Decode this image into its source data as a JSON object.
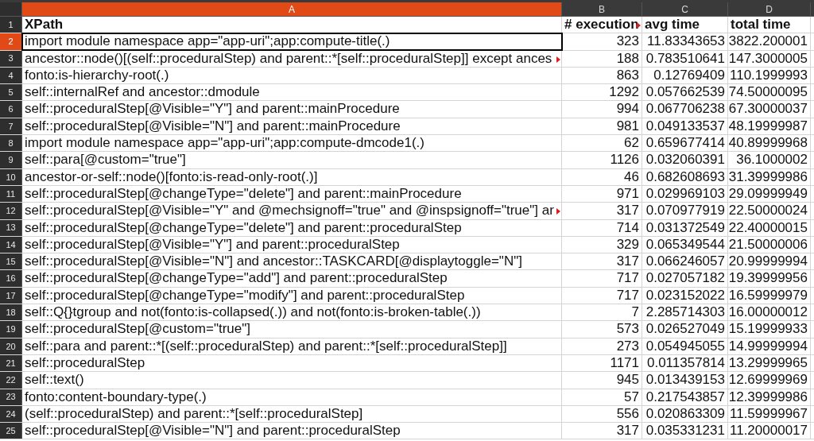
{
  "columns": [
    {
      "letter": "A",
      "selected": true
    },
    {
      "letter": "B",
      "selected": false
    },
    {
      "letter": "C",
      "selected": false
    },
    {
      "letter": "D",
      "selected": false
    }
  ],
  "rows": [
    {
      "number": "1",
      "selected": false,
      "kind": "header",
      "cells": [
        {
          "text": "XPath",
          "overflow": false
        },
        {
          "text": "# execution",
          "overflow": true
        },
        {
          "text": "avg time",
          "overflow": false
        },
        {
          "text": "total time",
          "overflow": false
        }
      ]
    },
    {
      "number": "2",
      "selected": true,
      "kind": "data",
      "cells": [
        {
          "text": "import module namespace app=\"app-uri\";app:compute-title(.)",
          "overflow": false
        },
        {
          "text": "323",
          "overflow": false
        },
        {
          "text": "11.83343653",
          "overflow": false
        },
        {
          "text": "3822.200001",
          "overflow": false
        }
      ]
    },
    {
      "number": "3",
      "selected": false,
      "kind": "data",
      "cells": [
        {
          "text": "ancestor::node()[(self::proceduralStep) and parent::*[self::proceduralStep]] except ances",
          "overflow": true
        },
        {
          "text": "188",
          "overflow": false
        },
        {
          "text": "0.783510641",
          "overflow": false
        },
        {
          "text": "147.3000005",
          "overflow": false
        }
      ]
    },
    {
      "number": "4",
      "selected": false,
      "kind": "data",
      "cells": [
        {
          "text": "fonto:is-hierarchy-root(.)",
          "overflow": false
        },
        {
          "text": "863",
          "overflow": false
        },
        {
          "text": "0.12769409",
          "overflow": false
        },
        {
          "text": "110.1999993",
          "overflow": false
        }
      ]
    },
    {
      "number": "5",
      "selected": false,
      "kind": "data",
      "cells": [
        {
          "text": "self::internalRef and ancestor::dmodule",
          "overflow": false
        },
        {
          "text": "1292",
          "overflow": false
        },
        {
          "text": "0.057662539",
          "overflow": false
        },
        {
          "text": "74.50000095",
          "overflow": false
        }
      ]
    },
    {
      "number": "6",
      "selected": false,
      "kind": "data",
      "cells": [
        {
          "text": "self::proceduralStep[@Visible=\"Y\"] and parent::mainProcedure",
          "overflow": false
        },
        {
          "text": "994",
          "overflow": false
        },
        {
          "text": "0.067706238",
          "overflow": false
        },
        {
          "text": "67.30000037",
          "overflow": false
        }
      ]
    },
    {
      "number": "7",
      "selected": false,
      "kind": "data",
      "cells": [
        {
          "text": "self::proceduralStep[@Visible=\"N\"] and parent::mainProcedure",
          "overflow": false
        },
        {
          "text": "981",
          "overflow": false
        },
        {
          "text": "0.049133537",
          "overflow": false
        },
        {
          "text": "48.19999987",
          "overflow": false
        }
      ]
    },
    {
      "number": "8",
      "selected": false,
      "kind": "data",
      "cells": [
        {
          "text": "import module namespace app=\"app-uri\";app:compute-dmcode1(.)",
          "overflow": false
        },
        {
          "text": "62",
          "overflow": false
        },
        {
          "text": "0.659677414",
          "overflow": false
        },
        {
          "text": "40.89999968",
          "overflow": false
        }
      ]
    },
    {
      "number": "9",
      "selected": false,
      "kind": "data",
      "cells": [
        {
          "text": "self::para[@custom=\"true\"]",
          "overflow": false
        },
        {
          "text": "1126",
          "overflow": false
        },
        {
          "text": "0.032060391",
          "overflow": false
        },
        {
          "text": "36.1000002",
          "overflow": false
        }
      ]
    },
    {
      "number": "10",
      "selected": false,
      "kind": "data",
      "cells": [
        {
          "text": "ancestor-or-self::node()[fonto:is-read-only-root(.)]",
          "overflow": false
        },
        {
          "text": "46",
          "overflow": false
        },
        {
          "text": "0.682608693",
          "overflow": false
        },
        {
          "text": "31.39999986",
          "overflow": false
        }
      ]
    },
    {
      "number": "11",
      "selected": false,
      "kind": "data",
      "cells": [
        {
          "text": "self::proceduralStep[@changeType=\"delete\"] and parent::mainProcedure",
          "overflow": false
        },
        {
          "text": "971",
          "overflow": false
        },
        {
          "text": "0.029969103",
          "overflow": false
        },
        {
          "text": "29.09999949",
          "overflow": false
        }
      ]
    },
    {
      "number": "12",
      "selected": false,
      "kind": "data",
      "cells": [
        {
          "text": "self::proceduralStep[@Visible=\"Y\" and @mechsignoff=\"true\" and @inspsignoff=\"true\"] ar",
          "overflow": true
        },
        {
          "text": "317",
          "overflow": false
        },
        {
          "text": "0.070977919",
          "overflow": false
        },
        {
          "text": "22.50000024",
          "overflow": false
        }
      ]
    },
    {
      "number": "13",
      "selected": false,
      "kind": "data",
      "cells": [
        {
          "text": "self::proceduralStep[@changeType=\"delete\"] and parent::proceduralStep",
          "overflow": false
        },
        {
          "text": "714",
          "overflow": false
        },
        {
          "text": "0.031372549",
          "overflow": false
        },
        {
          "text": "22.40000015",
          "overflow": false
        }
      ]
    },
    {
      "number": "14",
      "selected": false,
      "kind": "data",
      "cells": [
        {
          "text": "self::proceduralStep[@Visible=\"Y\"] and parent::proceduralStep",
          "overflow": false
        },
        {
          "text": "329",
          "overflow": false
        },
        {
          "text": "0.065349544",
          "overflow": false
        },
        {
          "text": "21.50000006",
          "overflow": false
        }
      ]
    },
    {
      "number": "15",
      "selected": false,
      "kind": "data",
      "cells": [
        {
          "text": "self::proceduralStep[@Visible=\"N\"] and ancestor::TASKCARD[@displaytoggle=\"N\"]",
          "overflow": false
        },
        {
          "text": "317",
          "overflow": false
        },
        {
          "text": "0.066246057",
          "overflow": false
        },
        {
          "text": "20.99999994",
          "overflow": false
        }
      ]
    },
    {
      "number": "16",
      "selected": false,
      "kind": "data",
      "cells": [
        {
          "text": "self::proceduralStep[@changeType=\"add\"] and parent::proceduralStep",
          "overflow": false
        },
        {
          "text": "717",
          "overflow": false
        },
        {
          "text": "0.027057182",
          "overflow": false
        },
        {
          "text": "19.39999956",
          "overflow": false
        }
      ]
    },
    {
      "number": "17",
      "selected": false,
      "kind": "data",
      "cells": [
        {
          "text": "self::proceduralStep[@changeType=\"modify\"] and parent::proceduralStep",
          "overflow": false
        },
        {
          "text": "717",
          "overflow": false
        },
        {
          "text": "0.023152022",
          "overflow": false
        },
        {
          "text": "16.59999979",
          "overflow": false
        }
      ]
    },
    {
      "number": "18",
      "selected": false,
      "kind": "data",
      "cells": [
        {
          "text": "self::Q{}tgroup and not(fonto:is-collapsed(.)) and not(fonto:is-broken-table(.))",
          "overflow": false
        },
        {
          "text": "7",
          "overflow": false
        },
        {
          "text": "2.285714303",
          "overflow": false
        },
        {
          "text": "16.00000012",
          "overflow": false
        }
      ]
    },
    {
      "number": "19",
      "selected": false,
      "kind": "data",
      "cells": [
        {
          "text": "self::proceduralStep[@custom=\"true\"]",
          "overflow": false
        },
        {
          "text": "573",
          "overflow": false
        },
        {
          "text": "0.026527049",
          "overflow": false
        },
        {
          "text": "15.19999933",
          "overflow": false
        }
      ]
    },
    {
      "number": "20",
      "selected": false,
      "kind": "data",
      "cells": [
        {
          "text": "self::para and parent::*[(self::proceduralStep) and parent::*[self::proceduralStep]]",
          "overflow": false
        },
        {
          "text": "273",
          "overflow": false
        },
        {
          "text": "0.054945055",
          "overflow": false
        },
        {
          "text": "14.99999994",
          "overflow": false
        }
      ]
    },
    {
      "number": "21",
      "selected": false,
      "kind": "data",
      "cells": [
        {
          "text": "self::proceduralStep",
          "overflow": false
        },
        {
          "text": "1171",
          "overflow": false
        },
        {
          "text": "0.011357814",
          "overflow": false
        },
        {
          "text": "13.29999965",
          "overflow": false
        }
      ]
    },
    {
      "number": "22",
      "selected": false,
      "kind": "data",
      "cells": [
        {
          "text": "self::text()",
          "overflow": false
        },
        {
          "text": "945",
          "overflow": false
        },
        {
          "text": "0.013439153",
          "overflow": false
        },
        {
          "text": "12.69999969",
          "overflow": false
        }
      ]
    },
    {
      "number": "23",
      "selected": false,
      "kind": "data",
      "cells": [
        {
          "text": "fonto:content-boundary-type(.)",
          "overflow": false
        },
        {
          "text": "57",
          "overflow": false
        },
        {
          "text": "0.217543857",
          "overflow": false
        },
        {
          "text": "12.39999986",
          "overflow": false
        }
      ]
    },
    {
      "number": "24",
      "selected": false,
      "kind": "data",
      "cells": [
        {
          "text": "(self::proceduralStep) and parent::*[self::proceduralStep]",
          "overflow": false
        },
        {
          "text": "556",
          "overflow": false
        },
        {
          "text": "0.020863309",
          "overflow": false
        },
        {
          "text": "11.59999967",
          "overflow": false
        }
      ]
    },
    {
      "number": "25",
      "selected": false,
      "kind": "data",
      "cells": [
        {
          "text": "self::proceduralStep[@Visible=\"N\"] and parent::proceduralStep",
          "overflow": false
        },
        {
          "text": "317",
          "overflow": false
        },
        {
          "text": "0.035331231",
          "overflow": false
        },
        {
          "text": "11.20000017",
          "overflow": false
        }
      ]
    }
  ]
}
